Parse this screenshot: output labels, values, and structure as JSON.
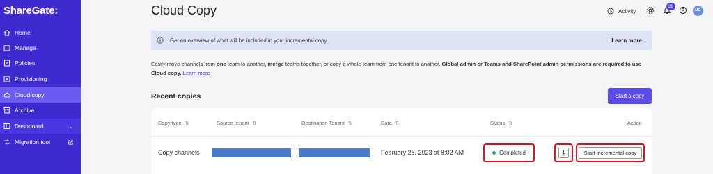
{
  "app": {
    "logo": "ShareGate:"
  },
  "sidebar": {
    "items": [
      {
        "label": "Home",
        "icon": "home-icon"
      },
      {
        "label": "Manage",
        "icon": "manage-icon"
      },
      {
        "label": "Policies",
        "icon": "policies-icon"
      },
      {
        "label": "Provisioning",
        "icon": "provisioning-icon"
      },
      {
        "label": "Cloud copy",
        "icon": "cloud-icon",
        "active": true
      },
      {
        "label": "Archive",
        "icon": "archive-icon"
      },
      {
        "label": "Dashboard",
        "icon": "dashboard-icon"
      },
      {
        "label": "Migration tool",
        "icon": "migration-icon"
      }
    ]
  },
  "header": {
    "title": "Cloud Copy",
    "activity_label": "Activity",
    "notification_count": "29",
    "avatar_initials": "MG"
  },
  "banner": {
    "text": "Get an overview of what will be included in your incremental copy.",
    "learn_more": "Learn more"
  },
  "description": {
    "p1": "Easily move channels from ",
    "b1": "one",
    "p2": " team to another, ",
    "b2": "merge",
    "p3": " teams together, or copy a whole team from one tenant to another. ",
    "b3": "Global admin or Teams and SharePoint admin permissions are required to use Cloud copy.",
    "link": "Learn more"
  },
  "recent": {
    "title": "Recent copies",
    "start_button": "Start a copy"
  },
  "table": {
    "columns": [
      "Copy type",
      "Source tenant",
      "Destination Tenant",
      "Date",
      "Status",
      "Action"
    ],
    "row": {
      "copy_type": "Copy channels",
      "date": "February 28, 2023 at 8:02 AM",
      "status": "Completed",
      "action_label": "Start incremental copy"
    }
  },
  "colors": {
    "sidebar": "#3d2bd0",
    "accent": "#5b4ee8",
    "highlight": "#e0101e",
    "success": "#2e9e5a"
  }
}
